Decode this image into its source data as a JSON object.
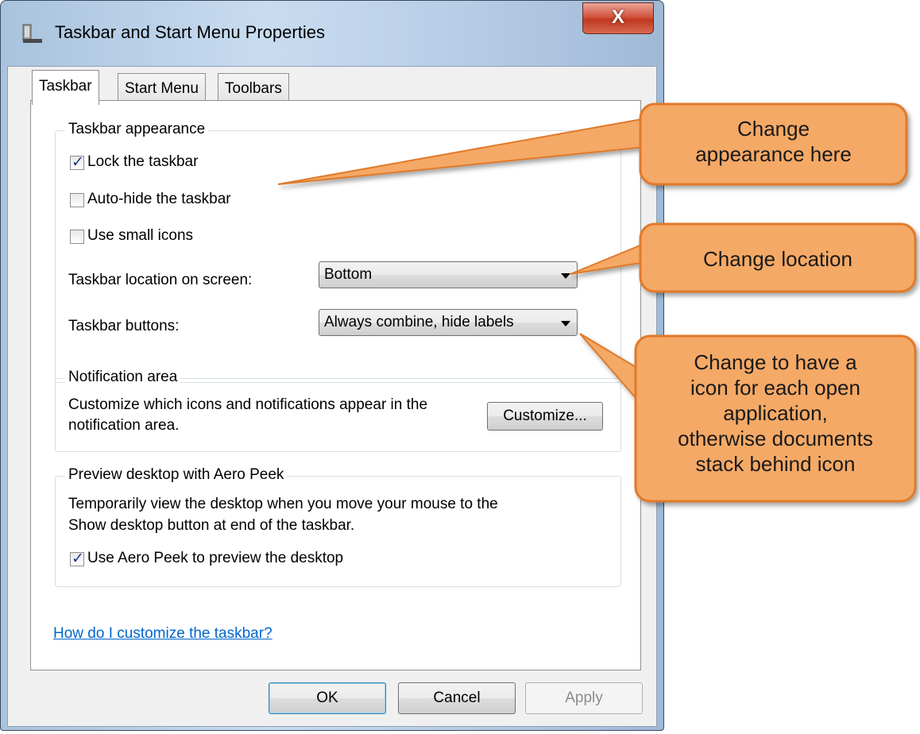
{
  "window": {
    "title": "Taskbar and Start Menu Properties",
    "close_glyph": "X"
  },
  "tabs": [
    {
      "label": "Taskbar",
      "active": true
    },
    {
      "label": "Start Menu",
      "active": false
    },
    {
      "label": "Toolbars",
      "active": false
    }
  ],
  "appearance": {
    "title": "Taskbar appearance",
    "lock_label": "Lock the taskbar",
    "lock_checked": true,
    "autohide_label": "Auto-hide the taskbar",
    "autohide_checked": false,
    "small_icons_label": "Use small icons",
    "small_icons_checked": false,
    "location_label": "Taskbar location on screen:",
    "location_value": "Bottom",
    "buttons_label": "Taskbar buttons:",
    "buttons_value": "Always combine, hide labels"
  },
  "notification": {
    "title": "Notification area",
    "description_line1": "Customize which icons and notifications appear in the",
    "description_line2": "notification area.",
    "customize_button": "Customize..."
  },
  "aero_peek": {
    "title": "Preview desktop with Aero Peek",
    "description_line1": "Temporarily view the desktop when you move your mouse to the",
    "description_line2": "Show desktop button at end of the taskbar.",
    "checkbox_label": "Use Aero Peek to preview the desktop",
    "checkbox_checked": true
  },
  "help_link": "How do I customize the taskbar?",
  "buttons": {
    "ok": "OK",
    "cancel": "Cancel",
    "apply": "Apply"
  },
  "callouts": {
    "appearance": [
      "Change",
      "appearance here"
    ],
    "location": [
      "Change location"
    ],
    "buttons": [
      "Change to have a",
      "icon for each open",
      "application,",
      "otherwise documents",
      "stack behind icon"
    ]
  },
  "colors": {
    "callout_fill": "#f5a966",
    "callout_stroke": "#e07a2a"
  },
  "icons": {
    "app": "taskbar-icon",
    "checkmark": "checkmark-icon",
    "dropdown": "chevron-down-icon"
  }
}
